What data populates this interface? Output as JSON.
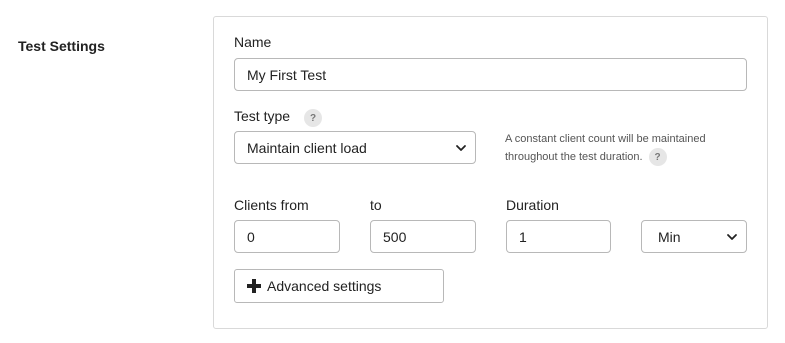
{
  "section": {
    "title": "Test Settings"
  },
  "name": {
    "label": "Name",
    "value": "My First Test"
  },
  "test_type": {
    "label": "Test type",
    "help": "?",
    "selected": "Maintain client load",
    "note": "A constant client count will be maintained throughout the test duration.",
    "note_help": "?"
  },
  "clients": {
    "from_label": "Clients from",
    "from_value": "0",
    "to_label": "to",
    "to_value": "500"
  },
  "duration": {
    "label": "Duration",
    "value": "1",
    "unit_selected": "Min"
  },
  "advanced": {
    "label": "Advanced settings",
    "icon": "plus-icon"
  }
}
